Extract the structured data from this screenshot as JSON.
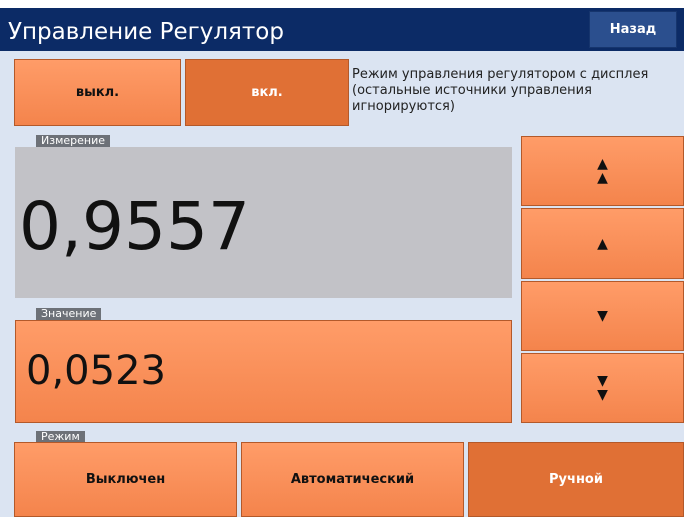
{
  "header": {
    "title": "Управление Регулятор",
    "back_label": "Назад"
  },
  "control": {
    "off_label": "выкл.",
    "on_label": "вкл.",
    "description": "Режим управления регулятором с дисплея (остальные источники управления игнорируются)"
  },
  "measurement": {
    "label": "Измерение",
    "value": "0,9557"
  },
  "setpoint": {
    "label": "Значение",
    "value": "0,0523"
  },
  "arrows": {
    "fast_up_icon": "double-up-arrow",
    "up_icon": "up-arrow",
    "down_icon": "down-arrow",
    "fast_down_icon": "double-down-arrow"
  },
  "mode": {
    "label": "Режим",
    "options": [
      "Выключен",
      "Автоматический",
      "Ручной"
    ],
    "selected": "Ручной"
  },
  "colors": {
    "header_bg": "#0c2b66",
    "button_light": "#f68a53",
    "button_active": "#e07035",
    "measure_bg": "#c2c2c7",
    "content_bg": "#dbe4f2"
  }
}
